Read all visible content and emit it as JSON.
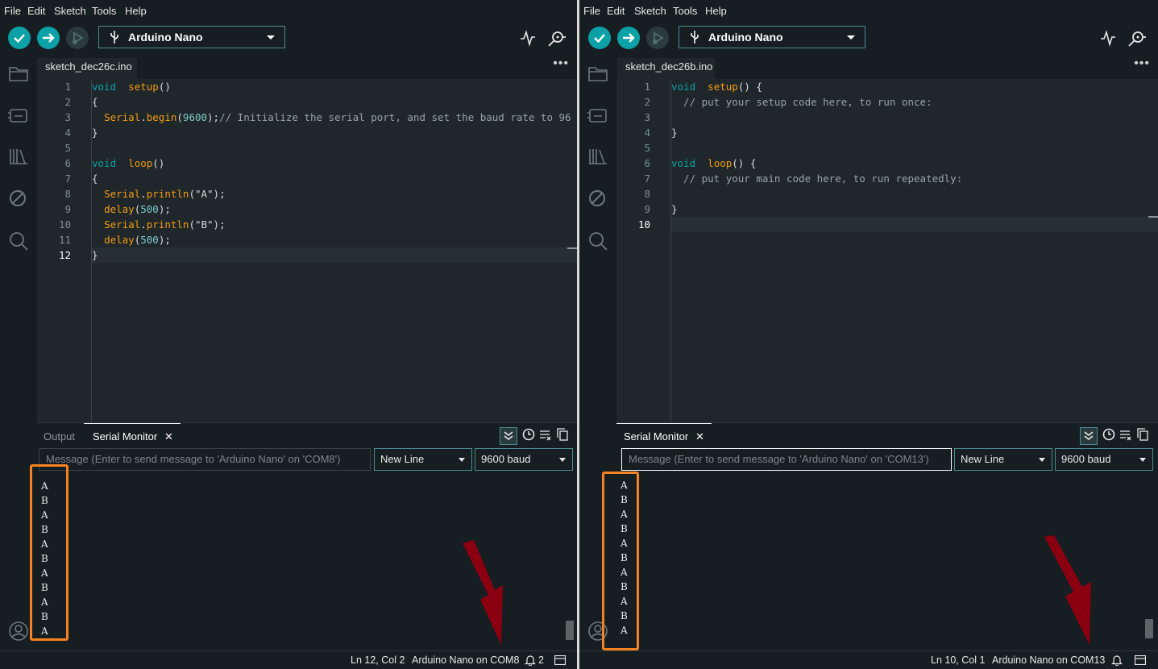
{
  "colors": {
    "accent": "#0ca1a6",
    "highlight": "#f58220",
    "arrow": "#8b0010"
  },
  "left": {
    "menu": [
      "File",
      "Edit",
      "Sketch",
      "Tools",
      "Help"
    ],
    "board": "Arduino Nano",
    "tab": "sketch_dec26c.ino",
    "more": "•••",
    "line_numbers": [
      "1",
      "2",
      "3",
      "4",
      "5",
      "6",
      "7",
      "8",
      "9",
      "10",
      "11",
      "12"
    ],
    "code_lines": [
      [
        [
          "kw",
          "void"
        ],
        [
          "",
          "  "
        ],
        [
          "fn",
          "setup"
        ],
        [
          "",
          "()"
        ]
      ],
      [
        [
          "",
          "{"
        ]
      ],
      [
        [
          "",
          "  "
        ],
        [
          "fn",
          "Serial"
        ],
        [
          "",
          "."
        ],
        [
          "fn",
          "begin"
        ],
        [
          "",
          "("
        ],
        [
          "num",
          "9600"
        ],
        [
          "",
          ");"
        ],
        [
          "cm",
          "// Initialize the serial port, and set the baud rate to 96"
        ]
      ],
      [
        [
          "",
          "}"
        ]
      ],
      [],
      [
        [
          "kw",
          "void"
        ],
        [
          "",
          "  "
        ],
        [
          "fn",
          "loop"
        ],
        [
          "",
          "()"
        ]
      ],
      [
        [
          "",
          "{"
        ]
      ],
      [
        [
          "",
          "  "
        ],
        [
          "fn",
          "Serial"
        ],
        [
          "",
          "."
        ],
        [
          "fn",
          "println"
        ],
        [
          "",
          "("
        ],
        [
          "str",
          "\"A\""
        ],
        [
          "",
          ");"
        ]
      ],
      [
        [
          "",
          "  "
        ],
        [
          "fn",
          "delay"
        ],
        [
          "",
          "("
        ],
        [
          "num",
          "500"
        ],
        [
          "",
          ");"
        ]
      ],
      [
        [
          "",
          "  "
        ],
        [
          "fn",
          "Serial"
        ],
        [
          "",
          "."
        ],
        [
          "fn",
          "println"
        ],
        [
          "",
          "("
        ],
        [
          "str",
          "\"B\""
        ],
        [
          "",
          ");"
        ]
      ],
      [
        [
          "",
          "  "
        ],
        [
          "fn",
          "delay"
        ],
        [
          "",
          "("
        ],
        [
          "num",
          "500"
        ],
        [
          "",
          ");"
        ]
      ],
      [
        [
          "",
          "}"
        ]
      ]
    ],
    "panel_tabs": {
      "output": "Output",
      "serial": "Serial Monitor",
      "close": "✕"
    },
    "message_placeholder": "Message (Enter to send message to 'Arduino Nano' on 'COM8')",
    "line_ending": "New Line",
    "baud": "9600 baud",
    "serial_output": [
      "A",
      "B",
      "A",
      "B",
      "A",
      "B",
      "A",
      "B",
      "A",
      "B",
      "A"
    ],
    "status": {
      "position": "Ln 12, Col 2",
      "board_port": "Arduino Nano on COM8",
      "notifications": "2"
    }
  },
  "right": {
    "menu": [
      "File",
      "Edit",
      "Sketch",
      "Tools",
      "Help"
    ],
    "board": "Arduino Nano",
    "tab": "sketch_dec26b.ino",
    "more": "•••",
    "line_numbers": [
      "1",
      "2",
      "3",
      "4",
      "5",
      "6",
      "7",
      "8",
      "9",
      "10"
    ],
    "code_lines": [
      [
        [
          "kw",
          "void"
        ],
        [
          "",
          "  "
        ],
        [
          "fn",
          "setup"
        ],
        [
          "",
          "() {"
        ]
      ],
      [
        [
          "cm",
          "  // put your setup code here, to run once:"
        ]
      ],
      [],
      [
        [
          "",
          "}"
        ]
      ],
      [],
      [
        [
          "kw",
          "void"
        ],
        [
          "",
          "  "
        ],
        [
          "fn",
          "loop"
        ],
        [
          "",
          "() {"
        ]
      ],
      [
        [
          "cm",
          "  // put your main code here, to run repeatedly:"
        ]
      ],
      [],
      [
        [
          "",
          "}"
        ]
      ],
      []
    ],
    "panel_tabs": {
      "serial": "Serial Monitor",
      "close": "✕"
    },
    "message_placeholder": "Message (Enter to send message to 'Arduino Nano' on 'COM13')",
    "line_ending": "New Line",
    "baud": "9600 baud",
    "serial_output": [
      "A",
      "B",
      "A",
      "B",
      "A",
      "B",
      "A",
      "B",
      "A",
      "B",
      "A"
    ],
    "status": {
      "position": "Ln 10, Col 1",
      "board_port": "Arduino Nano on COM13"
    }
  }
}
